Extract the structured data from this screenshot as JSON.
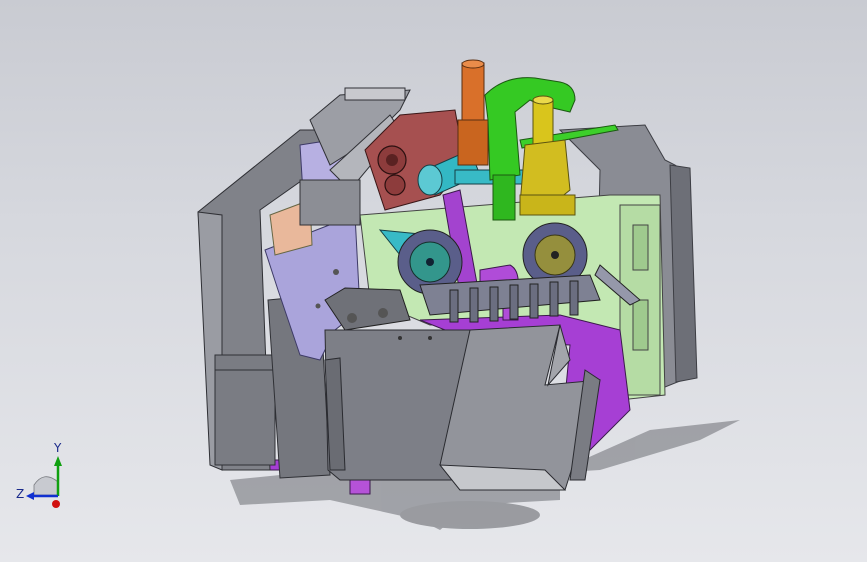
{
  "viewport": {
    "background_top": "#c9cbd2",
    "background_bottom": "#e6e7eb"
  },
  "model": {
    "description_colors": {
      "frame_gray": "#7d7f86",
      "panel_lavender": "#a9a3d9",
      "purple": "#a33bd1",
      "green_pipe": "#33cc22",
      "orange_pipe": "#d86a1a",
      "yellow": "#d8c21a",
      "cyan": "#2fb7c3",
      "maroon": "#a24a4a",
      "light_green_frame": "#bfe7b0",
      "teal_wheel": "#2f8f86",
      "olive_wheel": "#8f8a3a"
    }
  },
  "triad": {
    "x_label": "",
    "y_label": "Y",
    "z_label": "Z",
    "x_color": "#d01010",
    "y_color": "#10a010",
    "z_color": "#1030d0"
  }
}
